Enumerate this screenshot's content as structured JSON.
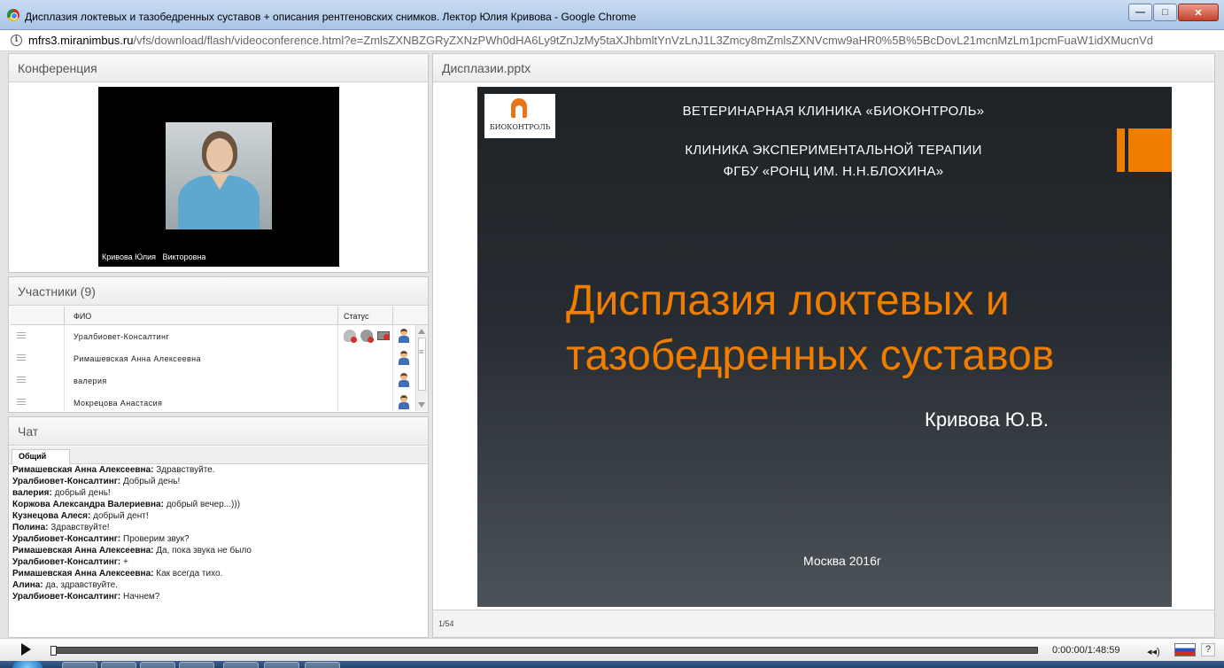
{
  "window": {
    "title": "Дисплазия локтевых и тазобедренных суставов + описания рентгеновских снимков. Лектор Юлия Кривова - Google Chrome",
    "buttons": {
      "minimize": "—",
      "maximize": "□",
      "close": "✕"
    }
  },
  "address": {
    "domain": "mfrs3.miranimbus.ru",
    "path": "/vfs/download/flash/videoconference.html?e=ZmlsZXNBZGRyZXNzPWh0dHA6Ly9tZnJzMy5taXJhbmltYnVzLnJ1L3Zmcy8mZmlsZXNVcmw9aHR0%5B%5BcDovL21mcnMzLm1pcmFuaW1idXMucnVd"
  },
  "conference": {
    "title": "Конференция",
    "speaker_name": "Кривова Юлия   Викторовна"
  },
  "participants": {
    "title": "Участники (9)",
    "columns": {
      "name": "ФИО",
      "status": "Статус"
    },
    "rows": [
      {
        "name": "Уралбиовет-Консалтинг"
      },
      {
        "name": "Римашевская Анна  Алексеевна"
      },
      {
        "name": "валерия"
      },
      {
        "name": "Мокрецова Анастасия"
      }
    ]
  },
  "chat": {
    "title": "Чат",
    "tab": "Общий",
    "messages": [
      {
        "author": "Римашевская Анна  Алексеевна:",
        "text": "Здравствуйте."
      },
      {
        "author": "Уралбиовет-Консалтинг:",
        "text": "Добрый день!"
      },
      {
        "author": "валерия:",
        "text": "добрый день!"
      },
      {
        "author": "Коржова Александра  Валериевна:",
        "text": "добрый вечер...)))"
      },
      {
        "author": "Кузнецова Алеся:",
        "text": "добрый дент!"
      },
      {
        "author": "Полина:",
        "text": "Здравствуйте!"
      },
      {
        "author": "Уралбиовет-Консалтинг:",
        "text": "Проверим звук?"
      },
      {
        "author": "Римашевская Анна  Алексеевна:",
        "text": "Да, пока звука не было"
      },
      {
        "author": "Уралбиовет-Консалтинг:",
        "text": "+"
      },
      {
        "author": "Римашевская Анна  Алексеевна:",
        "text": "Как всегда тихо."
      },
      {
        "author": "Алина:",
        "text": "да, здравствуйте."
      },
      {
        "author": "Уралбиовет-Консалтинг:",
        "text": "Начнем?"
      }
    ]
  },
  "presentation": {
    "title": "Дисплазии.pptx",
    "page": "1/54",
    "slide": {
      "logo_text": "БИОКОНТРОЛЬ",
      "header1": "ВЕТЕРИНАРНАЯ КЛИНИКА «БИОКОНТРОЛЬ»",
      "header2": "КЛИНИКА ЭКСПЕРИМЕНТАЛЬНОЙ ТЕРАПИИ",
      "header3": "ФГБУ «РОНЦ ИМ. Н.Н.БЛОХИНА»",
      "title_line1": "Дисплазия локтевых и",
      "title_line2": "тазобедренных суставов",
      "author": "Кривова Ю.В.",
      "city": "Москва 2016г"
    }
  },
  "player": {
    "time": "0:00:00/1:48:59",
    "help": "?",
    "volume": "◂◂)"
  },
  "colors": {
    "accent": "#f07c00",
    "slide_bg": "#1e2327"
  }
}
